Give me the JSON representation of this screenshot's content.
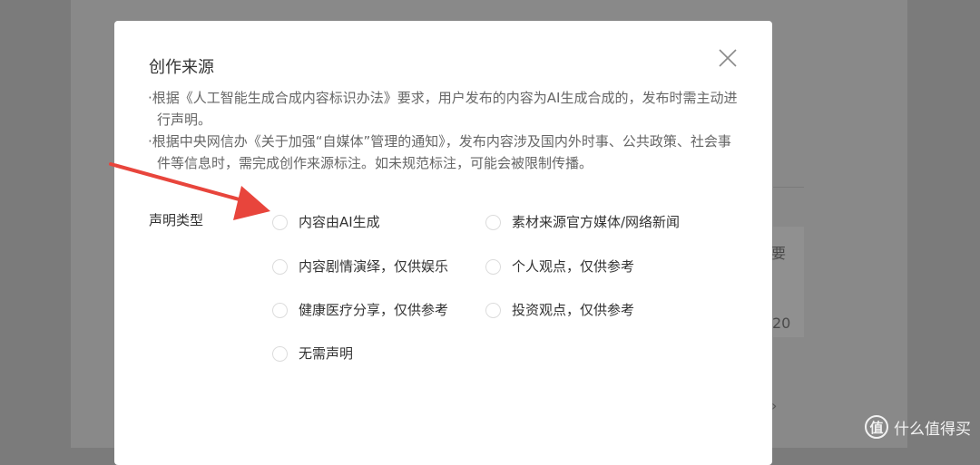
{
  "background": {
    "partial_text_1": "要",
    "partial_text_2": "20",
    "chevron": "›"
  },
  "modal": {
    "title": "创作来源",
    "notices": [
      "·根据《人工智能生成合成内容标识办法》要求，用户发布的内容为AI生成合成的，发布时需主动进行声明。",
      "·根据中央网信办《关于加强“自媒体”管理的通知》，发布内容涉及国内外时事、公共政策、社会事件等信息时，需完成创作来源标注。如未规范标注，可能会被限制传播。"
    ],
    "declaration_label": "声明类型",
    "options": [
      "内容由AI生成",
      "素材来源官方媒体/网络新闻",
      "内容剧情演绎，仅供娱乐",
      "个人观点，仅供参考",
      "健康医疗分享，仅供参考",
      "投资观点，仅供参考",
      "无需声明"
    ]
  },
  "watermark": {
    "logo": "值",
    "text": "什么值得买"
  },
  "colors": {
    "overlay": "#7b7b7b",
    "modal_bg": "#ffffff",
    "arrow": "#e8453c",
    "title_text": "#333333",
    "notice_text": "#666666"
  }
}
